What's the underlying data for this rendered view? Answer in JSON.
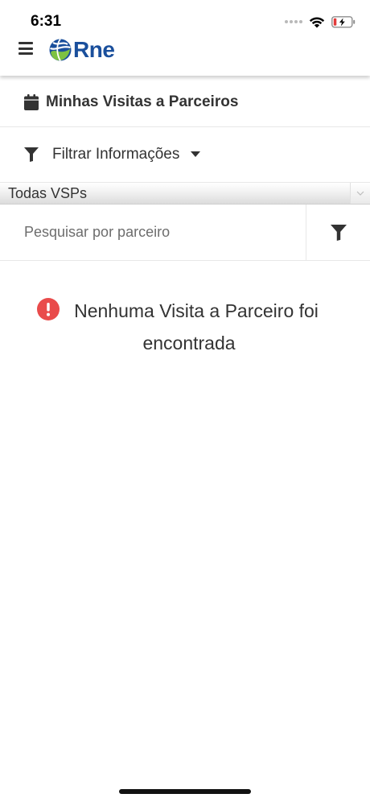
{
  "status_bar": {
    "time": "6:31"
  },
  "header": {
    "logo_text": "Rne",
    "menu_icon": "hamburger-icon"
  },
  "page": {
    "title": "Minhas Visitas a Parceiros",
    "title_icon": "calendar-icon"
  },
  "filter": {
    "label": "Filtrar Informações",
    "icon": "funnel-icon"
  },
  "vsp_select": {
    "value": "Todas VSPs"
  },
  "search": {
    "placeholder": "Pesquisar por parceiro",
    "value": ""
  },
  "empty_state": {
    "line1": "Nenhuma Visita a Parceiro foi",
    "line2": "encontrada",
    "icon": "alert-circle-icon"
  },
  "colors": {
    "brand_blue": "#1a4f9c",
    "brand_green": "#7dc242",
    "alert_red": "#e94b4b",
    "text": "#333333"
  }
}
